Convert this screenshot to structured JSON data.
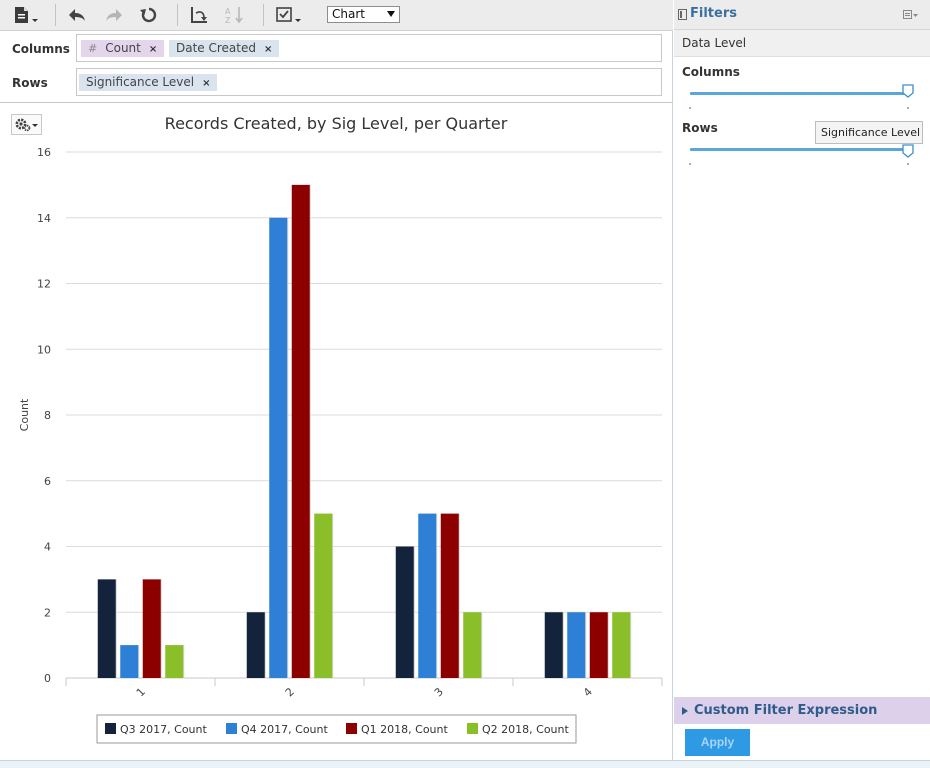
{
  "toolbar": {
    "view_select": "Chart",
    "icons": [
      "export-icon",
      "undo-icon",
      "redo-icon",
      "reset-icon",
      "swap-axes-icon",
      "sort-icon",
      "checklist-icon"
    ]
  },
  "shelves": {
    "columns_label": "Columns",
    "rows_label": "Rows",
    "columns_pills": [
      {
        "hash": "#",
        "label": "Count",
        "kind": "measure"
      },
      {
        "label": "Date Created",
        "kind": "dimension"
      }
    ],
    "rows_pills": [
      {
        "label": "Significance Level",
        "kind": "dimension"
      }
    ],
    "remove_glyph": "×"
  },
  "filters": {
    "title": "Filters",
    "data_level": "Data Level",
    "columns_label": "Columns",
    "rows_label": "Rows",
    "tooltip": "Significance Level",
    "custom_filter": "Custom Filter Expression",
    "apply": "Apply",
    "columns_slider_level": 1,
    "rows_slider_level": 1
  },
  "chart_data": {
    "type": "bar",
    "title": "Records Created, by Sig Level, per Quarter",
    "xlabel": "",
    "ylabel": "Count",
    "ylim": [
      0,
      16
    ],
    "yticks": [
      0,
      2,
      4,
      6,
      8,
      10,
      12,
      14,
      16
    ],
    "grid": true,
    "legend_position": "bottom",
    "categories": [
      "1",
      "2",
      "3",
      "4"
    ],
    "series": [
      {
        "name": "Q3 2017, Count",
        "color": "#12233b",
        "values": [
          3,
          2,
          4,
          2
        ]
      },
      {
        "name": "Q4 2017, Count",
        "color": "#2e7fd6",
        "values": [
          1,
          14,
          5,
          2
        ]
      },
      {
        "name": "Q1 2018, Count",
        "color": "#8c0000",
        "values": [
          3,
          15,
          5,
          2
        ]
      },
      {
        "name": "Q2 2018, Count",
        "color": "#8abf2a",
        "values": [
          1,
          5,
          2,
          2
        ]
      }
    ]
  }
}
